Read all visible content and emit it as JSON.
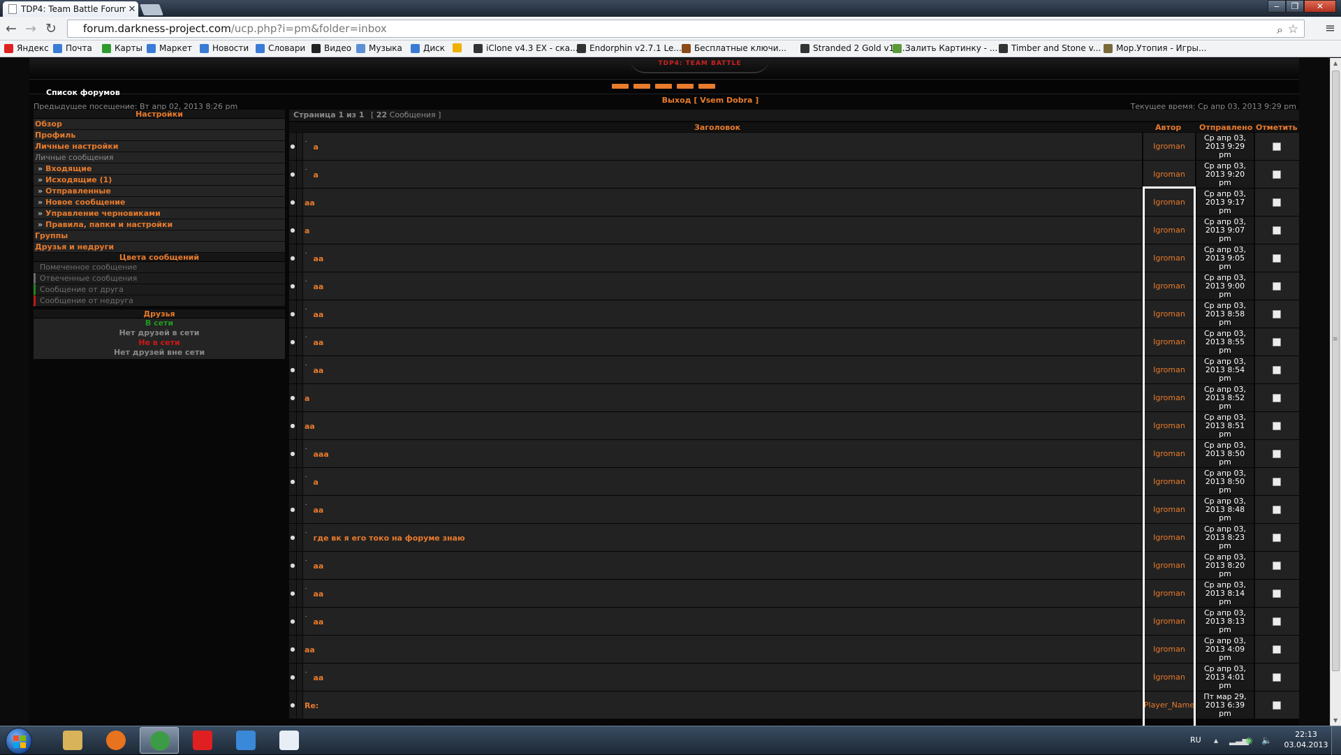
{
  "browser": {
    "tab_title": "TDP4: Team Battle Forum",
    "tab_close": "✕",
    "url_host": "forum.darkness-project.com",
    "url_path": "/ucp.php?i=pm&folder=inbox",
    "bookmarks": [
      {
        "label": "Яндекс",
        "color": "#e02020"
      },
      {
        "label": "Почта",
        "color": "#3a7bd5"
      },
      {
        "label": "Карты",
        "color": "#2f9a2f"
      },
      {
        "label": "Маркет",
        "color": "#3a7bd5"
      },
      {
        "label": "Новости",
        "color": "#3a7bd5"
      },
      {
        "label": "Словари",
        "color": "#3a7bd5"
      },
      {
        "label": "Видео",
        "color": "#222222"
      },
      {
        "label": "Музыка",
        "color": "#5b8fd6"
      },
      {
        "label": "Диск",
        "color": "#3a7bd5"
      },
      {
        "label": "",
        "color": "#f0b000"
      },
      {
        "label": "iClone v4.3 EX - ска...",
        "color": "#333333"
      },
      {
        "label": "Endorphin v2.7.1 Le...",
        "color": "#333333"
      },
      {
        "label": "Бесплатные ключи...",
        "color": "#8a4a1a"
      },
      {
        "label": "Stranded 2 Gold v1.0...",
        "color": "#333333"
      },
      {
        "label": "Залить Картинку - ...",
        "color": "#5a9a3a"
      },
      {
        "label": "Timber and Stone v...",
        "color": "#333333"
      },
      {
        "label": "Мор.Утопия - Игры...",
        "color": "#7a6a3a"
      }
    ]
  },
  "forum": {
    "logo_text": "TDP4: TEAM BATTLE",
    "forum_list": "Список форумов",
    "logout": "Выход [ Vsem Dobra ]",
    "prev_visit": "Предыдущее посещение: Вт апр 02, 2013 8:26 pm",
    "current_time": "Текущее время: Ср апр 03, 2013 9:29 pm",
    "accent": "#e87b2c"
  },
  "sidebar": {
    "settings_header": "Настройки",
    "items": [
      {
        "label": "Обзор",
        "style": "main"
      },
      {
        "label": "Профиль",
        "style": "main"
      },
      {
        "label": "Личные настройки",
        "style": "main"
      },
      {
        "label": "Личные сообщения",
        "style": "gray"
      },
      {
        "label": "Входящие",
        "style": "sub"
      },
      {
        "label": "Исходящие (1)",
        "style": "sub"
      },
      {
        "label": "Отправленные",
        "style": "sub"
      },
      {
        "label": "Новое сообщение",
        "style": "sub"
      },
      {
        "label": "Управление черновиками",
        "style": "sub"
      },
      {
        "label": "Правила, папки и настройки",
        "style": "sub"
      },
      {
        "label": "Группы",
        "style": "main"
      },
      {
        "label": "Друзья и недруги",
        "style": "main"
      }
    ],
    "sub_arrow": "»",
    "colors_header": "Цвета сообщений",
    "color_items": [
      {
        "label": "Помеченное сообщение",
        "bar": "#1c1c1c"
      },
      {
        "label": "Отвеченные сообщения",
        "bar": "#6a6a6a"
      },
      {
        "label": "Сообщение от друга",
        "bar": "#1a8a1a"
      },
      {
        "label": "Сообщение от недруга",
        "bar": "#c01818"
      }
    ],
    "friends_header": "Друзья",
    "friends": {
      "online_label": "В сети",
      "online_none": "Нет друзей в сети",
      "offline_label": "Не в сети",
      "offline_none": "Нет друзей вне сети",
      "online_color": "#1f9a1f",
      "offline_color": "#d01818"
    }
  },
  "messages": {
    "pagination": "Страница 1 из 1",
    "count_open": "[",
    "count": "22",
    "count_label": "Сообщения ]",
    "columns": {
      "subject": "Заголовок",
      "author": "Автор",
      "sent": "Отправлено",
      "mark": "Отметить"
    },
    "rows": [
      {
        "tick": true,
        "subject": "a",
        "author": "Igroman",
        "d1": "Ср апр 03,",
        "d2": "2013 9:29",
        "d3": "pm"
      },
      {
        "tick": true,
        "subject": "a",
        "author": "Igroman",
        "d1": "Ср апр 03,",
        "d2": "2013 9:20",
        "d3": "pm"
      },
      {
        "tick": false,
        "subject": "аа",
        "author": "Igroman",
        "d1": "Ср апр 03,",
        "d2": "2013 9:17",
        "d3": "pm"
      },
      {
        "tick": false,
        "subject": "а",
        "author": "Igroman",
        "d1": "Ср апр 03,",
        "d2": "2013 9:07",
        "d3": "pm"
      },
      {
        "tick": true,
        "subject": "аа",
        "author": "Igroman",
        "d1": "Ср апр 03,",
        "d2": "2013 9:05",
        "d3": "pm"
      },
      {
        "tick": true,
        "subject": "аа",
        "author": "Igroman",
        "d1": "Ср апр 03,",
        "d2": "2013 9:00",
        "d3": "pm"
      },
      {
        "tick": true,
        "subject": "аа",
        "author": "Igroman",
        "d1": "Ср апр 03,",
        "d2": "2013 8:58",
        "d3": "pm"
      },
      {
        "tick": true,
        "subject": "аа",
        "author": "Igroman",
        "d1": "Ср апр 03,",
        "d2": "2013 8:55",
        "d3": "pm"
      },
      {
        "tick": true,
        "subject": "аа",
        "author": "Igroman",
        "d1": "Ср апр 03,",
        "d2": "2013 8:54",
        "d3": "pm"
      },
      {
        "tick": false,
        "subject": "а",
        "author": "Igroman",
        "d1": "Ср апр 03,",
        "d2": "2013 8:52",
        "d3": "pm"
      },
      {
        "tick": false,
        "subject": "аа",
        "author": "Igroman",
        "d1": "Ср апр 03,",
        "d2": "2013 8:51",
        "d3": "pm"
      },
      {
        "tick": true,
        "subject": "ааа",
        "author": "Igroman",
        "d1": "Ср апр 03,",
        "d2": "2013 8:50",
        "d3": "pm"
      },
      {
        "tick": true,
        "subject": "а",
        "author": "Igroman",
        "d1": "Ср апр 03,",
        "d2": "2013 8:50",
        "d3": "pm"
      },
      {
        "tick": true,
        "subject": "аа",
        "author": "Igroman",
        "d1": "Ср апр 03,",
        "d2": "2013 8:48",
        "d3": "pm"
      },
      {
        "tick": true,
        "subject": "где вк я его токо на форуме знаю",
        "author": "Igroman",
        "d1": "Ср апр 03,",
        "d2": "2013 8:23",
        "d3": "pm"
      },
      {
        "tick": true,
        "subject": "аа",
        "author": "Igroman",
        "d1": "Ср апр 03,",
        "d2": "2013 8:20",
        "d3": "pm"
      },
      {
        "tick": true,
        "subject": "аа",
        "author": "Igroman",
        "d1": "Ср апр 03,",
        "d2": "2013 8:14",
        "d3": "pm"
      },
      {
        "tick": true,
        "subject": "аа",
        "author": "Igroman",
        "d1": "Ср апр 03,",
        "d2": "2013 8:13",
        "d3": "pm"
      },
      {
        "tick": false,
        "subject": "аа",
        "author": "Igroman",
        "d1": "Ср апр 03,",
        "d2": "2013 4:09",
        "d3": "pm"
      },
      {
        "tick": true,
        "subject": "аа",
        "author": "Igroman",
        "d1": "Ср апр 03,",
        "d2": "2013 4:01",
        "d3": "pm"
      },
      {
        "tick": false,
        "subject": "Re:",
        "author": "Player_Name",
        "d1": "Пт мар 29,",
        "d2": "2013 6:39",
        "d3": "pm"
      }
    ]
  },
  "taskbar": {
    "apps": [
      {
        "name": "explorer",
        "color": "#d8b35a"
      },
      {
        "name": "firefox",
        "color": "#e8731e"
      },
      {
        "name": "chrome",
        "color": "#3c9b46"
      },
      {
        "name": "yandex",
        "color": "#e02020"
      },
      {
        "name": "sound",
        "color": "#3a88d8"
      },
      {
        "name": "notepad",
        "color": "#e8eef5"
      }
    ],
    "lang": "RU",
    "time": "22:13",
    "date": "03.04.2013"
  }
}
